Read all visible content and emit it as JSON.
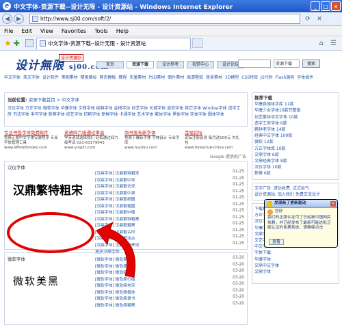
{
  "window": {
    "title": "中文字体-资源下载--设计无限 - 设计资源站 - Windows Internet Explorer",
    "controls": {
      "minimize": "_",
      "maximize": "□",
      "close": "×"
    }
  },
  "address_bar": {
    "back_icon": "back-arrow-icon",
    "forward_icon": "forward-arrow-icon",
    "url": "http://www.sj00.com/soft/2/"
  },
  "menu": [
    "File",
    "Edit",
    "View",
    "Favorites",
    "Tools",
    "Help"
  ],
  "tab": {
    "label": "中文字体-资源下载--设计无限 - 设计资源站"
  },
  "site": {
    "logo": "设计無限",
    "logo_domain": "sj00.com",
    "logo_badge": "设计资源站",
    "nav": [
      "首页",
      "资源下载",
      "设计参考",
      "视觉中心",
      "设计论坛"
    ],
    "search_select": "资源下载",
    "search_button": "搜索"
  },
  "top_categories": "中文字体 英文字体 设计软件 笔刷素材 精美图标 网页模板 教程 矢量素材 PSD素材 图片素材 高清壁纸 背景素材 3D模型 CSS特效 JS代码 Flash源码 字体插件",
  "crumb": {
    "prefix": "当前位置:",
    "path": "资源下载首页 > 中文字体"
  },
  "sub_categories": "汉仪字体 方正字体 微软字体 华康字体 文鼎字体 经典字体 金梅字体 创艺字体 长城字体 迷你字体 其它字体 Window字体 造字工房 书法字体 手写字体 新蒂字体 综艺字体 印刷字体 新鲜字体 卡通字体 艺术字体 繁体字体 黑体字体 宋体字体 圆体字体",
  "ads": [
    {
      "title": "专业书签字体免费软件",
      "text": "免费正版中文字体安装程序 专业字体管理工具",
      "url": "www.WhiteSmoke.com"
    },
    {
      "title": "英语四六级通过率高",
      "text": "学英语就选择我们 轻松通过四六级考试 021-63179043",
      "url": "www.yinglit.com"
    },
    {
      "title": "尚书发布新字体",
      "text": "免费下载新字体 字体设计 专业字库",
      "url": "www.huiziku.com"
    },
    {
      "title": "金福论坛",
      "text": "论坛注册会员 每月送100元 大礼包",
      "url": "www.forexclub-china.com"
    }
  ],
  "google_label": "Google 提供的广告",
  "section1": {
    "title": "汉仪字体",
    "preview": "汉鼎繁特粗宋",
    "items": [
      {
        "name": "[汉鼎字体] 汉鼎繁特粗宋",
        "date": "01-25"
      },
      {
        "name": "[汉鼎字体] 汉鼎繁中宋",
        "date": "01-25"
      },
      {
        "name": "[汉鼎字体] 汉鼎繁仿宋",
        "date": "01-25"
      },
      {
        "name": "[汉鼎字体] 汉鼎繁中隶",
        "date": "01-25"
      },
      {
        "name": "[汉鼎字体] 汉鼎繁细圆",
        "date": "01-25"
      },
      {
        "name": "[汉鼎字体] 汉鼎繁粗圆",
        "date": "01-25"
      },
      {
        "name": "[汉鼎字体] 汉鼎繁中楷",
        "date": "01-25"
      },
      {
        "name": "[汉鼎字体] 汉鼎繁特粗黑",
        "date": "01-25"
      },
      {
        "name": "[汉鼎字体] 汉鼎繁粗黑",
        "date": "01-25"
      },
      {
        "name": "[汉鼎字体] 汉鼎繁古印",
        "date": "01-25"
      },
      {
        "name": "[汉鼎字体] 汉鼎繁淡古",
        "date": "01-25"
      },
      {
        "name": "[汉鼎字体] 汉鼎繁勘亭流",
        "date": "01-25"
      }
    ],
    "more": "更多汉鼎字体..."
  },
  "section2": {
    "title": "微软字体",
    "preview": "微软美黑",
    "items": [
      {
        "name": "[微软字体] 微软美黑",
        "date": "03-20"
      },
      {
        "name": "[微软字体] 微软简报宋",
        "date": "03-20"
      },
      {
        "name": "[微软字体] 微软简中圆",
        "date": "03-20"
      },
      {
        "name": "[微软字体] 微软简行楷",
        "date": "03-20"
      },
      {
        "name": "[微软字体] 微软简老宋",
        "date": "03-20"
      },
      {
        "name": "[微软字体] 微软简楷体",
        "date": "03-20"
      },
      {
        "name": "[微软字体] 微软简隶书",
        "date": "03-20"
      },
      {
        "name": "[微软字体] 微软简粗黑",
        "date": "03-20"
      }
    ]
  },
  "right": {
    "title": "推荐下载",
    "items": [
      "华康自强体字库 11款",
      "华康少女字体16款完整版",
      "创艺繁体中文字体 10款",
      "造字工房字体 6款",
      "腾祥老字体 14款",
      "经典中文字体 100款",
      "微软 12款",
      "方正字体库 10款",
      "文鼎字体 6款",
      "文鼎经典字体 8款",
      "汉仪字体 10款",
      "新蒂 6款"
    ],
    "ad_title": "文字广告: 进站收费, 试试运气",
    "ad_text": "设计资源站: 加入我们 免费交流设计",
    "box3_title": "下载排行",
    "box3_items": [
      "方正字体",
      "汉仪字体",
      "华康字体",
      "文鼎字体",
      "文艺字体",
      "中文字体",
      "字体下载",
      "华康字体",
      "文鼎中文字体",
      "文鼎字体"
    ]
  },
  "balloon": {
    "title": "发现新了更新驱动",
    "greet": "您好",
    "text": "我们的正版认证可了已经被中国网民依赖，并已经发布了最新可能这批正版认证的免费系统，请确保点击",
    "button": "查看"
  },
  "colors": {
    "accent": "#2255aa",
    "highlight": "#e30000",
    "title_bar": "#1f56c9"
  }
}
